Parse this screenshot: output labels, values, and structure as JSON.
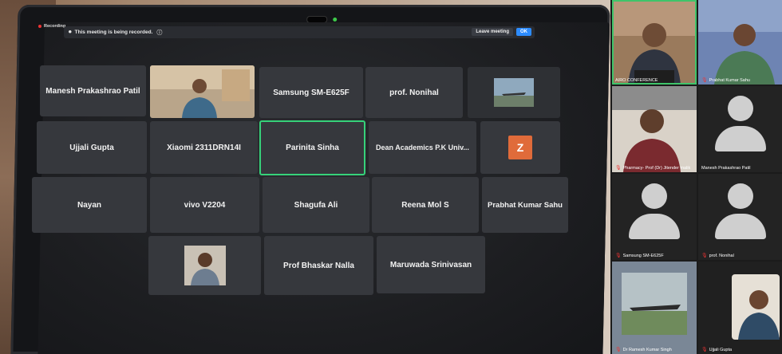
{
  "meeting": {
    "recording_label": "Recording",
    "recording_banner": "This meeting is being recorded.",
    "leave_label": "Leave meeting",
    "ok_label": "OK"
  },
  "gallery": [
    {
      "name": "Manesh Prakashrao Patil"
    },
    {
      "name": ""
    },
    {
      "name": "Samsung SM-E625F"
    },
    {
      "name": "prof. Nonihal"
    },
    {
      "name": ""
    },
    {
      "name": "Ujjali Gupta"
    },
    {
      "name": "Xiaomi 2311DRN14I"
    },
    {
      "name": "Parinita Sinha"
    },
    {
      "name": "Dean Academics P.K Univ..."
    },
    {
      "name": "Z"
    },
    {
      "name": "Nayan"
    },
    {
      "name": "vivo V2204"
    },
    {
      "name": "Shagufa Ali"
    },
    {
      "name": "Reena Mol S"
    },
    {
      "name": "Prabhat Kumar Sahu"
    },
    {
      "name": ""
    },
    {
      "name": "Prof Bhaskar Nalla"
    },
    {
      "name": "Maruwada Srinivasan"
    }
  ],
  "side_panel": [
    {
      "name": "AIRO CONFERENCE"
    },
    {
      "name": "Prabhat Kumar Sahu"
    },
    {
      "name": "Pharmacy- Prof (Dr) Jitender malik"
    },
    {
      "name": "Manesh Prakashrao Patil"
    },
    {
      "name": "Samsung SM-E625F"
    },
    {
      "name": "prof. Nonihal"
    },
    {
      "name": "Dr Ramesh Kumar Singh"
    },
    {
      "name": "Ujjali Gupta"
    }
  ],
  "colors": {
    "accent": "#2d8cff",
    "active_speaker": "#3fc46a",
    "muted": "#e33333"
  }
}
